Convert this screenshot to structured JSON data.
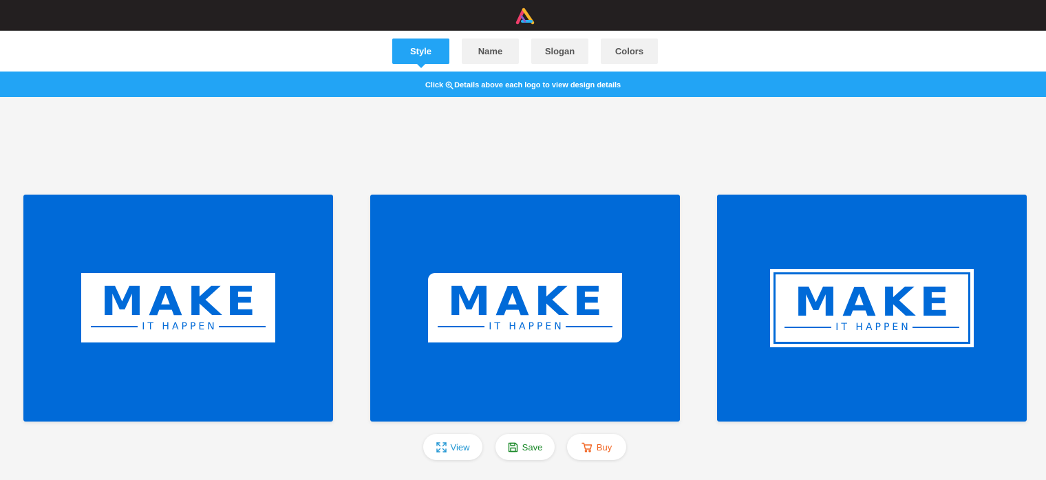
{
  "tabs": [
    {
      "label": "Style",
      "active": true
    },
    {
      "label": "Name",
      "active": false
    },
    {
      "label": "Slogan",
      "active": false
    },
    {
      "label": "Colors",
      "active": false
    }
  ],
  "info": {
    "prefix": "Click",
    "icon": "zoom-in-icon",
    "suffix": "Details above each logo to view design details"
  },
  "logos": [
    {
      "title": "MAKE",
      "subtitle": "IT HAPPEN",
      "frame": "plain"
    },
    {
      "title": "MAKE",
      "subtitle": "IT HAPPEN",
      "frame": "rounded-corner"
    },
    {
      "title": "MAKE",
      "subtitle": "IT HAPPEN",
      "frame": "double-border"
    }
  ],
  "actions": {
    "view": "View",
    "save": "Save",
    "buy": "Buy"
  },
  "colors": {
    "topbar": "#231f20",
    "accent": "#22a4f5",
    "logo_blue": "#006ad8",
    "view": "#2196d3",
    "save": "#1d8a2b",
    "buy": "#f26522"
  },
  "icons": {
    "app_logo": "triangle-logo-icon",
    "view": "expand-icon",
    "save": "floppy-disk-icon",
    "buy": "shopping-cart-icon"
  }
}
